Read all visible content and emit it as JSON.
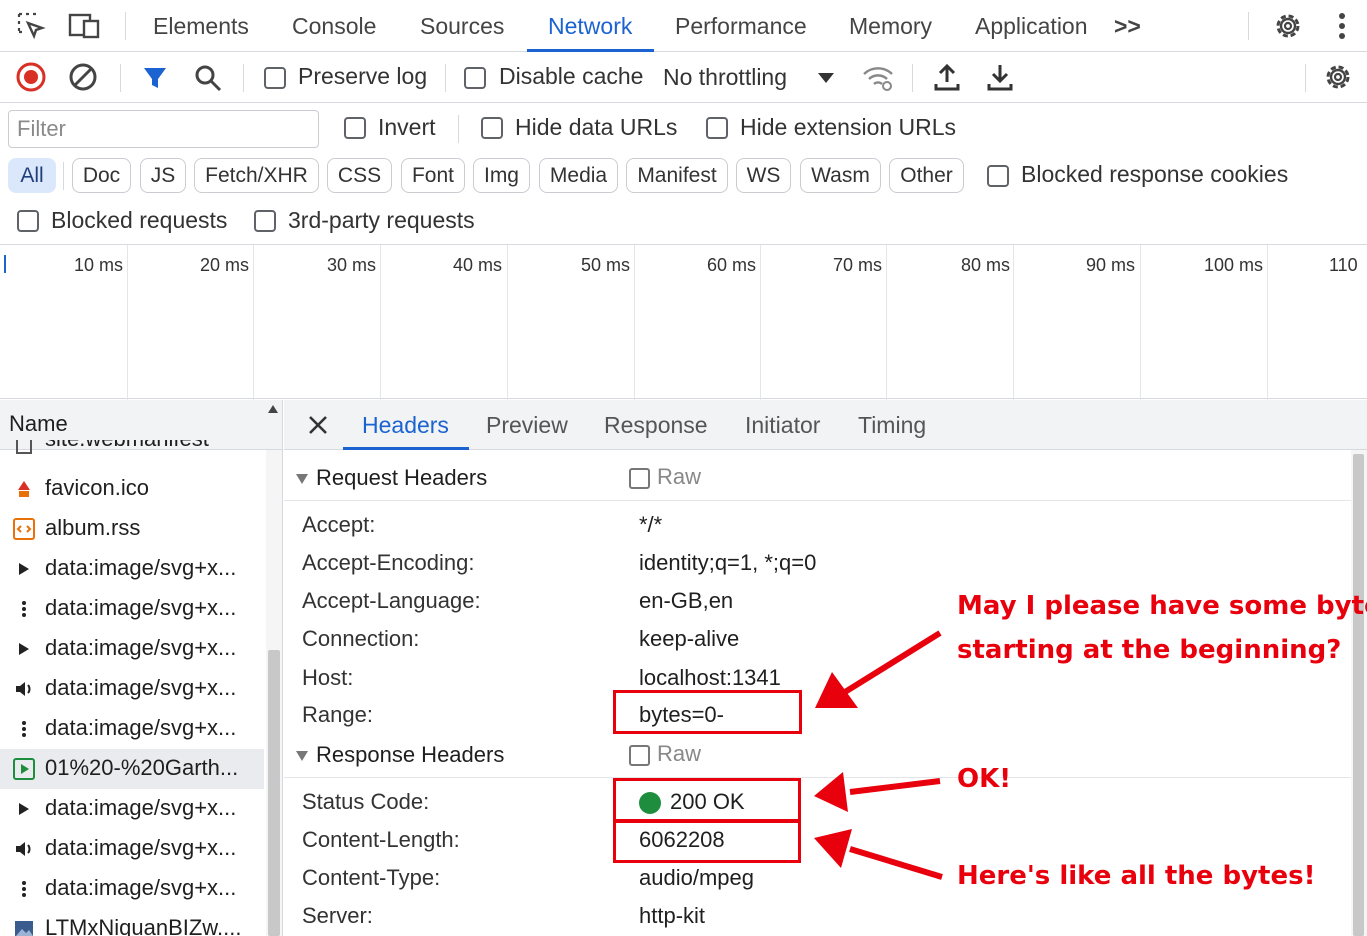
{
  "tabbar": {
    "tabs": [
      "Elements",
      "Console",
      "Sources",
      "Network",
      "Performance",
      "Memory",
      "Application"
    ],
    "active_tab": "Network",
    "more_label": ">>"
  },
  "toolbar": {
    "preserve_log": "Preserve log",
    "disable_cache": "Disable cache",
    "throttling": "No throttling"
  },
  "filter": {
    "placeholder": "Filter",
    "invert": "Invert",
    "hide_data_urls": "Hide data URLs",
    "hide_extension_urls": "Hide extension URLs"
  },
  "types": [
    "All",
    "Doc",
    "JS",
    "Fetch/XHR",
    "CSS",
    "Font",
    "Img",
    "Media",
    "Manifest",
    "WS",
    "Wasm",
    "Other"
  ],
  "active_type": "All",
  "blocked_response_cookies": "Blocked response cookies",
  "blocked_requests": "Blocked requests",
  "third_party_requests": "3rd-party requests",
  "timeline": {
    "ticks": [
      "10 ms",
      "20 ms",
      "30 ms",
      "40 ms",
      "50 ms",
      "60 ms",
      "70 ms",
      "80 ms",
      "90 ms",
      "100 ms",
      "110"
    ]
  },
  "names": {
    "header": "Name",
    "rows": [
      {
        "icon": "manifest-icon",
        "text": "site.webmanifest"
      },
      {
        "icon": "favicon-icon",
        "text": "favicon.ico"
      },
      {
        "icon": "rss-icon",
        "text": "album.rss"
      },
      {
        "icon": "play-icon",
        "text": "data:image/svg+x..."
      },
      {
        "icon": "dots-icon",
        "text": "data:image/svg+x..."
      },
      {
        "icon": "play-icon",
        "text": "data:image/svg+x..."
      },
      {
        "icon": "speaker-icon",
        "text": "data:image/svg+x..."
      },
      {
        "icon": "dots-icon",
        "text": "data:image/svg+x..."
      },
      {
        "icon": "media-icon",
        "text": "01%20-%20Garth..."
      },
      {
        "icon": "play-icon",
        "text": "data:image/svg+x..."
      },
      {
        "icon": "speaker-icon",
        "text": "data:image/svg+x..."
      },
      {
        "icon": "dots-icon",
        "text": "data:image/svg+x..."
      },
      {
        "icon": "image-icon",
        "text": "LTMxNiquanBIZw...."
      }
    ]
  },
  "details": {
    "tabs": [
      "Headers",
      "Preview",
      "Response",
      "Initiator",
      "Timing"
    ],
    "active_tab": "Headers",
    "request_headers_title": "Request Headers",
    "response_headers_title": "Response Headers",
    "raw_label": "Raw",
    "request_headers": [
      {
        "key": "Accept:",
        "value": "*/*"
      },
      {
        "key": "Accept-Encoding:",
        "value": "identity;q=1, *;q=0"
      },
      {
        "key": "Accept-Language:",
        "value": "en-GB,en"
      },
      {
        "key": "Connection:",
        "value": "keep-alive"
      },
      {
        "key": "Host:",
        "value": "localhost:1341"
      },
      {
        "key": "Range:",
        "value": "bytes=0-"
      }
    ],
    "response_headers": [
      {
        "key": "Status Code:",
        "value": "200 OK"
      },
      {
        "key": "Content-Length:",
        "value": "6062208"
      },
      {
        "key": "Content-Type:",
        "value": "audio/mpeg"
      },
      {
        "key": "Server:",
        "value": "http-kit"
      }
    ]
  },
  "annotations": {
    "note1_line1": "May I please have some bytes,",
    "note1_line2": "starting at the beginning?",
    "note2": "OK!",
    "note3": "Here's like all the bytes!",
    "color": "#e8000d"
  },
  "colors": {
    "accent": "#1a63d1",
    "record": "#d93025",
    "status_ok": "#1e8e3e"
  }
}
